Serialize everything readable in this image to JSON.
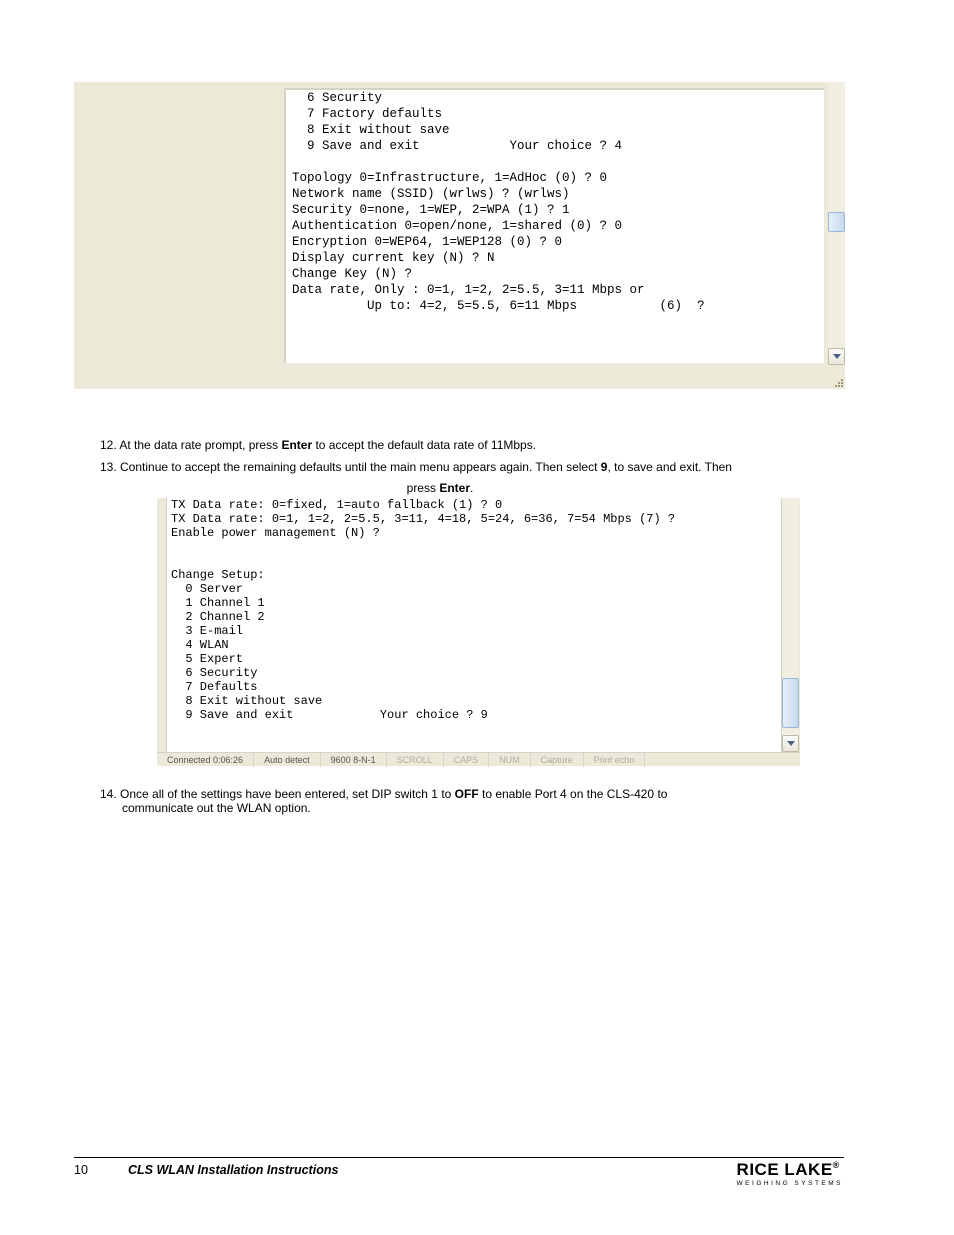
{
  "shot1": {
    "lines": [
      "  6 Security",
      "  7 Factory defaults",
      "  8 Exit without save",
      "  9 Save and exit            Your choice ? 4",
      "",
      "Topology 0=Infrastructure, 1=AdHoc (0) ? 0",
      "Network name (SSID) (wrlws) ? (wrlws)",
      "Security 0=none, 1=WEP, 2=WPA (1) ? 1",
      "Authentication 0=open/none, 1=shared (0) ? 0",
      "Encryption 0=WEP64, 1=WEP128 (0) ? 0",
      "Display current key (N) ? N",
      "Change Key (N) ?",
      "Data rate, Only : 0=1, 1=2, 2=5.5, 3=11 Mbps or",
      "          Up to: 4=2, 5=5.5, 6=11 Mbps           (6)  ?"
    ]
  },
  "instructions": {
    "line1_pre": "12. At the data rate prompt, press ",
    "line1_bold": "Enter",
    "line1_post": " to accept the default data rate of 11Mbps.",
    "line2_pre": "13. Continue to accept the remaining defaults until the main menu appears again. Then select ",
    "line2_bold": "9",
    "line2_post": ", to save and exit. Then",
    "line3_pre": "press ",
    "line3_bold": "Enter",
    "line3_post": "."
  },
  "shot2": {
    "lines": [
      "TX Data rate: 0=fixed, 1=auto fallback (1) ? 0",
      "TX Data rate: 0=1, 1=2, 2=5.5, 3=11, 4=18, 5=24, 6=36, 7=54 Mbps (7) ?",
      "Enable power management (N) ?",
      "",
      "",
      "Change Setup:",
      "  0 Server",
      "  1 Channel 1",
      "  2 Channel 2",
      "  3 E-mail",
      "  4 WLAN",
      "  5 Expert",
      "  6 Security",
      "  7 Defaults",
      "  8 Exit without save",
      "  9 Save and exit            Your choice ? 9"
    ],
    "status": {
      "connected": "Connected 0:06:26",
      "detect": "Auto detect",
      "port": "9600 8-N-1",
      "scroll": "SCROLL",
      "caps": "CAPS",
      "num": "NUM",
      "capture": "Capture",
      "echo": "Print echo"
    }
  },
  "instr4_pre": "14. Once all of the settings have been entered, set DIP switch 1 to ",
  "instr4_bold": "OFF",
  "instr4_post": " to enable Port 4 on the CLS-420 to",
  "instr4_line2": "communicate out the WLAN option.",
  "footer": {
    "pagenum": "10",
    "title": "CLS WLAN Installation Instructions",
    "logo_main": "RICE LAKE",
    "logo_sub": "WEIGHING SYSTEMS"
  }
}
